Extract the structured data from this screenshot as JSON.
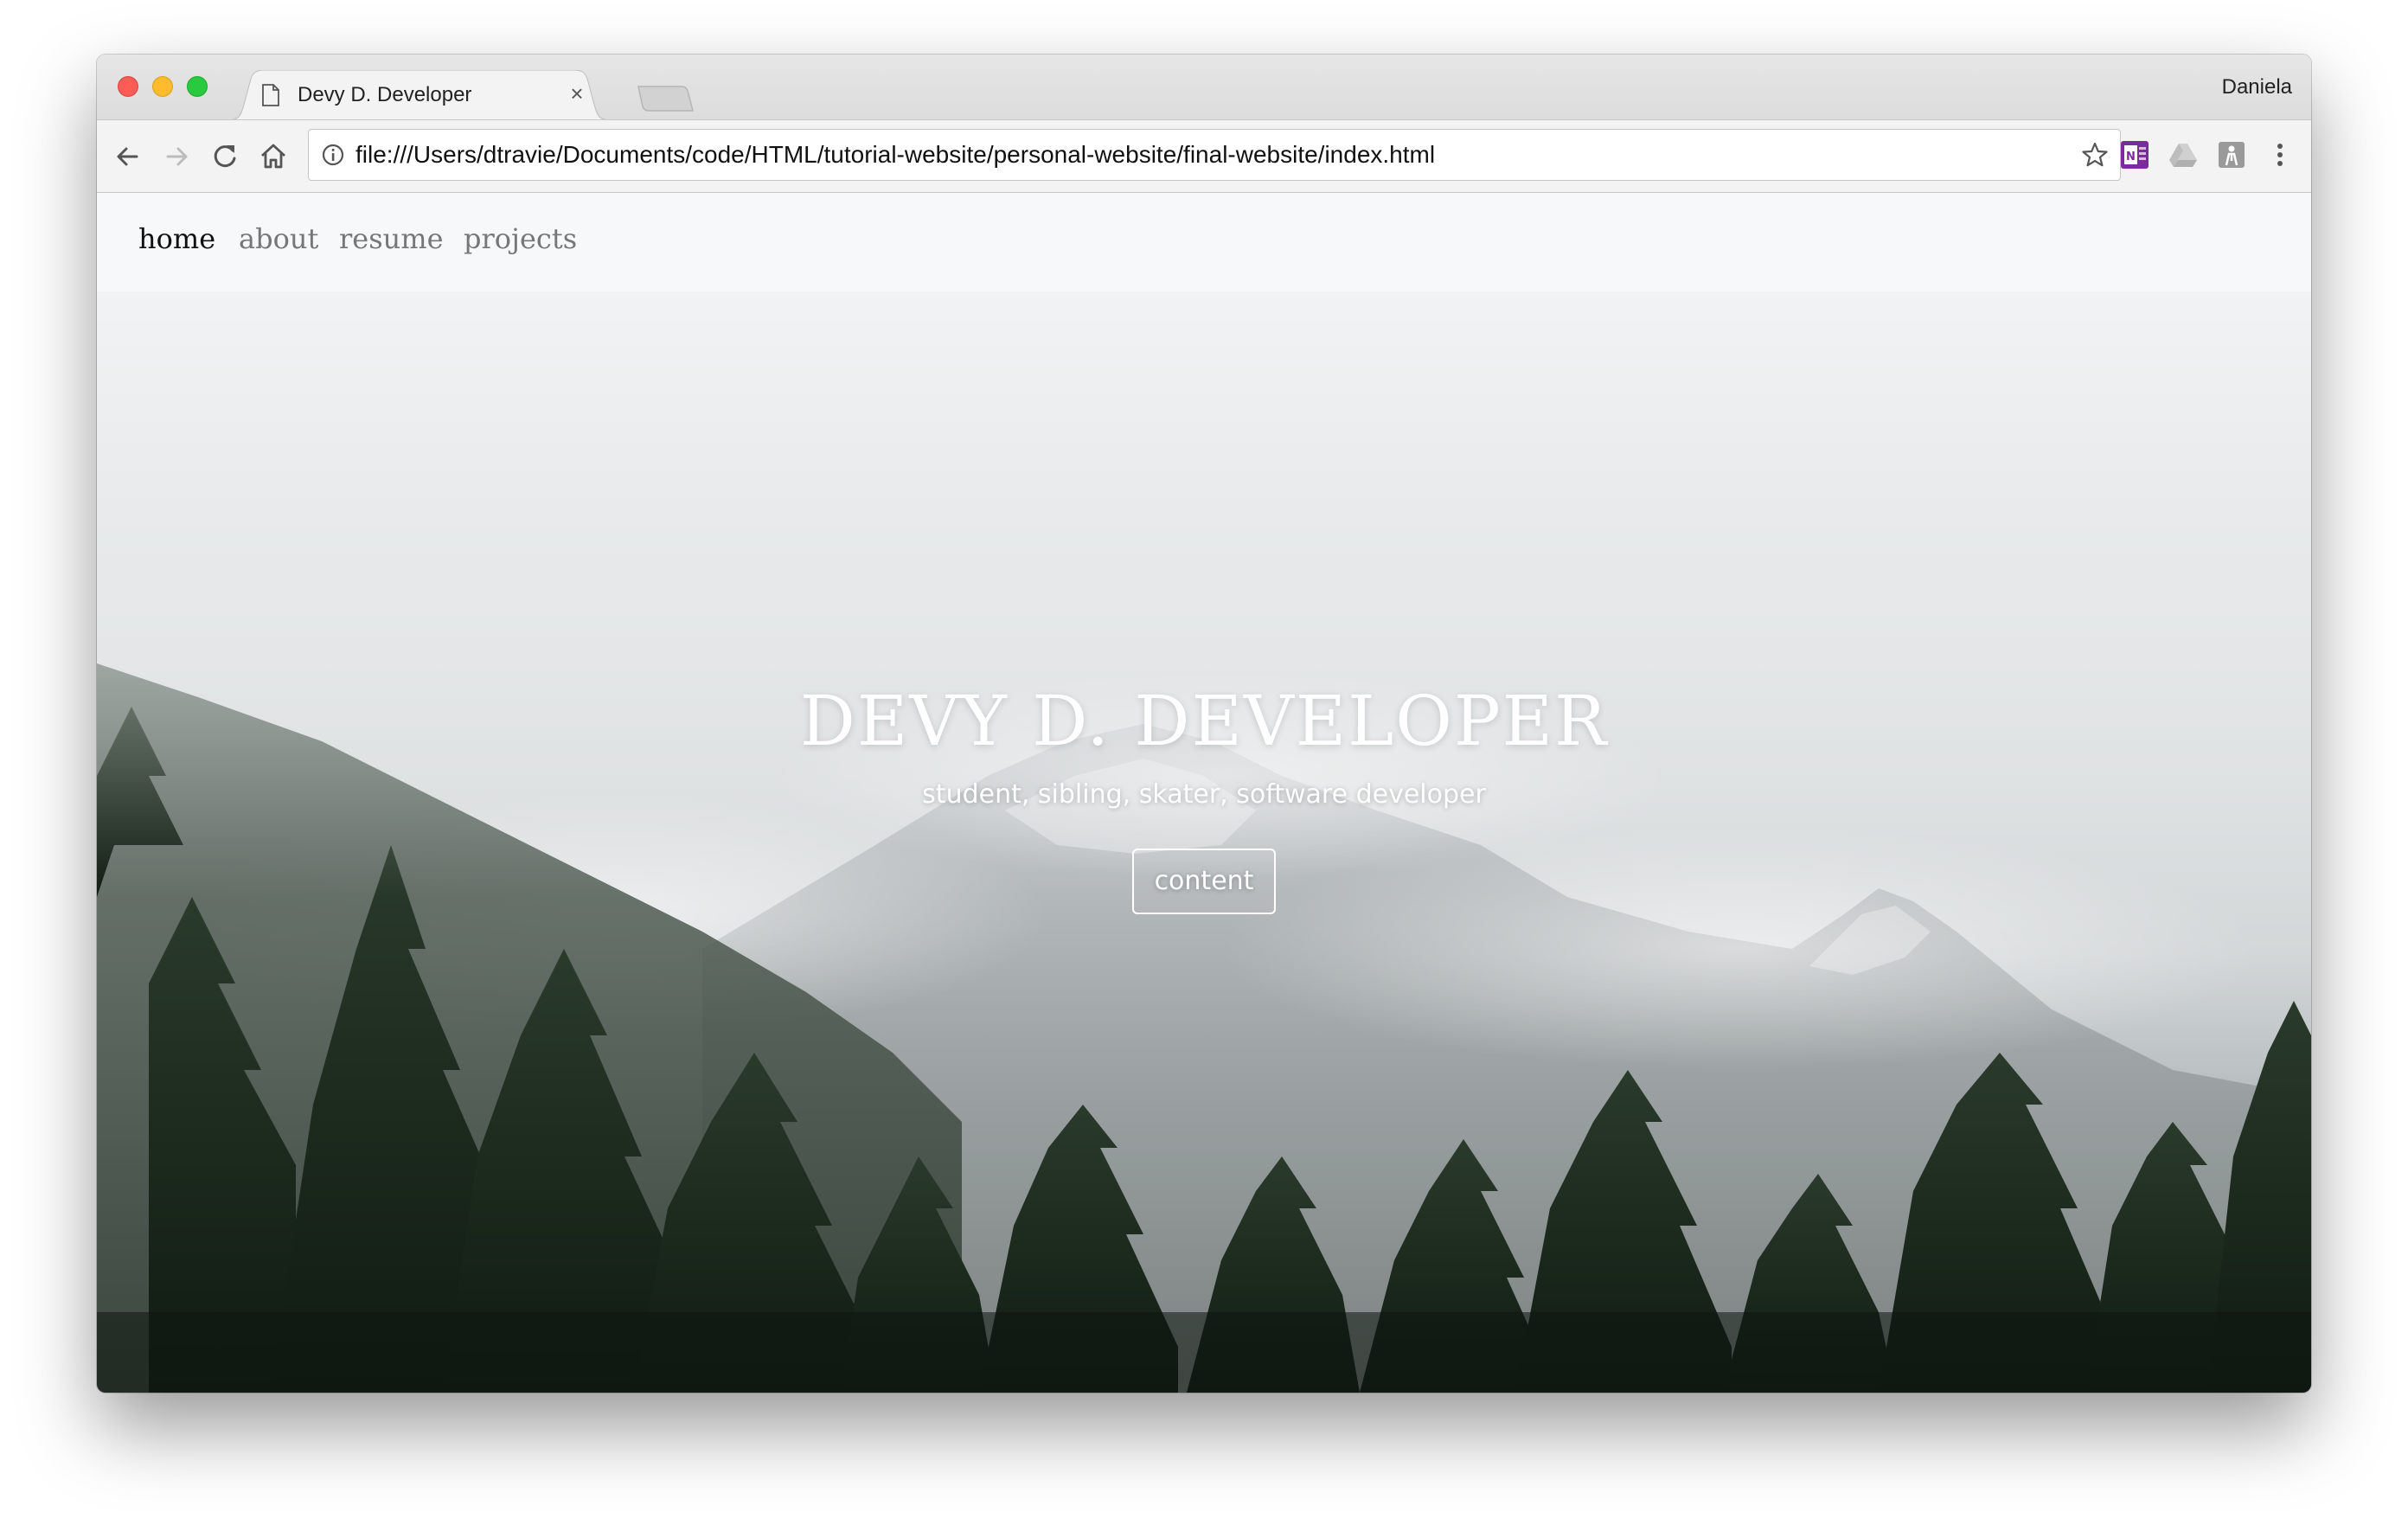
{
  "browser": {
    "tab_title": "Devy D. Developer",
    "tab_close": "×",
    "profile_name": "Daniela",
    "url": "file:///Users/dtravie/Documents/code/HTML/tutorial-website/personal-website/final-website/index.html",
    "icons": [
      "back-icon",
      "forward-icon",
      "reload-icon",
      "home-icon",
      "info-icon",
      "star-icon",
      "onenote-icon",
      "drive-icon",
      "extension-icon",
      "menu-icon"
    ]
  },
  "site": {
    "nav": {
      "home": "home",
      "about": "about",
      "resume": "resume",
      "projects": "projects"
    },
    "hero": {
      "title": "DEVY D. DEVELOPER",
      "subtitle": "student, sibling, skater, software developer",
      "button": "content"
    }
  },
  "colors": {
    "nav_active": "#111111",
    "nav_inactive": "#777777",
    "nav_background": "#f7f8f9",
    "hero_text": "#ffffff",
    "traffic_close": "#fd5d56",
    "traffic_minimize": "#fdbb2e",
    "traffic_maximize": "#29c940"
  }
}
